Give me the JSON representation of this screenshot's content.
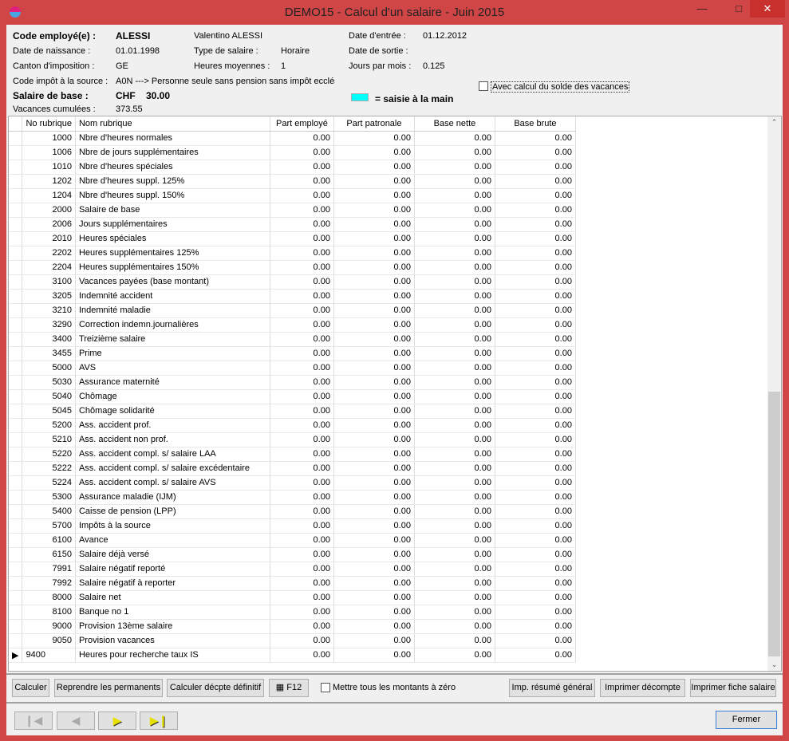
{
  "window": {
    "title": "DEMO15 - Calcul d'un salaire - Juin 2015"
  },
  "header": {
    "code_label": "Code employé(e) :",
    "code_value": "ALESSI",
    "full_name": "Valentino ALESSI",
    "birth_label": "Date de naissance :",
    "birth_value": "01.01.1998",
    "canton_label": "Canton d'imposition :",
    "canton_value": "GE",
    "tax_label": "Code impôt à la source :",
    "tax_value": "A0N ---> Personne seule sans pension sans impôt ecclési",
    "salary_label": "Salaire de  base :",
    "salary_currency": "CHF",
    "salary_value": "30.00",
    "vacation_label": "Vacances cumulées :",
    "vacation_value": "373.55",
    "type_label": "Type de salaire :",
    "type_value": "Horaire",
    "hours_label": "Heures moyennes :",
    "hours_value": "1",
    "entry_label": "Date d'entrée :",
    "entry_value": "01.12.2012",
    "exit_label": "Date de sortie :",
    "exit_value": "",
    "days_label": "Jours par mois :",
    "days_value": "0.125",
    "vac_checkbox_label": "Avec calcul du solde des vacances",
    "legend_label": "= saisie à la main",
    "legend_color": "#00ffff"
  },
  "table": {
    "columns": [
      "No rubrique",
      "Nom rubrique",
      "Part employé",
      "Part patronale",
      "Base nette",
      "Base brute"
    ],
    "rows": [
      [
        "1000",
        "Nbre d'heures normales",
        "0.00",
        "0.00",
        "0.00",
        "0.00"
      ],
      [
        "1006",
        "Nbre de jours supplémentaires",
        "0.00",
        "0.00",
        "0.00",
        "0.00"
      ],
      [
        "1010",
        "Nbre d'heures spéciales",
        "0.00",
        "0.00",
        "0.00",
        "0.00"
      ],
      [
        "1202",
        "Nbre d'heures suppl. 125%",
        "0.00",
        "0.00",
        "0.00",
        "0.00"
      ],
      [
        "1204",
        "Nbre d'heures suppl. 150%",
        "0.00",
        "0.00",
        "0.00",
        "0.00"
      ],
      [
        "2000",
        "Salaire de base",
        "0.00",
        "0.00",
        "0.00",
        "0.00"
      ],
      [
        "2006",
        "Jours supplémentaires",
        "0.00",
        "0.00",
        "0.00",
        "0.00"
      ],
      [
        "2010",
        "Heures spéciales",
        "0.00",
        "0.00",
        "0.00",
        "0.00"
      ],
      [
        "2202",
        "Heures supplémentaires 125%",
        "0.00",
        "0.00",
        "0.00",
        "0.00"
      ],
      [
        "2204",
        "Heures supplémentaires 150%",
        "0.00",
        "0.00",
        "0.00",
        "0.00"
      ],
      [
        "3100",
        "Vacances payées (base montant)",
        "0.00",
        "0.00",
        "0.00",
        "0.00"
      ],
      [
        "3205",
        "Indemnité accident",
        "0.00",
        "0.00",
        "0.00",
        "0.00"
      ],
      [
        "3210",
        "Indemnité maladie",
        "0.00",
        "0.00",
        "0.00",
        "0.00"
      ],
      [
        "3290",
        "Correction indemn.journalières",
        "0.00",
        "0.00",
        "0.00",
        "0.00"
      ],
      [
        "3400",
        "Treizième salaire",
        "0.00",
        "0.00",
        "0.00",
        "0.00"
      ],
      [
        "3455",
        "Prime",
        "0.00",
        "0.00",
        "0.00",
        "0.00"
      ],
      [
        "5000",
        "AVS",
        "0.00",
        "0.00",
        "0.00",
        "0.00"
      ],
      [
        "5030",
        "Assurance maternité",
        "0.00",
        "0.00",
        "0.00",
        "0.00"
      ],
      [
        "5040",
        "Chômage",
        "0.00",
        "0.00",
        "0.00",
        "0.00"
      ],
      [
        "5045",
        "Chômage solidarité",
        "0.00",
        "0.00",
        "0.00",
        "0.00"
      ],
      [
        "5200",
        "Ass. accident prof.",
        "0.00",
        "0.00",
        "0.00",
        "0.00"
      ],
      [
        "5210",
        "Ass. accident non prof.",
        "0.00",
        "0.00",
        "0.00",
        "0.00"
      ],
      [
        "5220",
        "Ass. accident compl. s/ salaire LAA",
        "0.00",
        "0.00",
        "0.00",
        "0.00"
      ],
      [
        "5222",
        "Ass. accident compl. s/ salaire excédentaire",
        "0.00",
        "0.00",
        "0.00",
        "0.00"
      ],
      [
        "5224",
        "Ass. accident compl. s/ salaire AVS",
        "0.00",
        "0.00",
        "0.00",
        "0.00"
      ],
      [
        "5300",
        "Assurance maladie (IJM)",
        "0.00",
        "0.00",
        "0.00",
        "0.00"
      ],
      [
        "5400",
        "Caisse de pension (LPP)",
        "0.00",
        "0.00",
        "0.00",
        "0.00"
      ],
      [
        "5700",
        "Impôts à la source",
        "0.00",
        "0.00",
        "0.00",
        "0.00"
      ],
      [
        "6100",
        "Avance",
        "0.00",
        "0.00",
        "0.00",
        "0.00"
      ],
      [
        "6150",
        "Salaire déjà versé",
        "0.00",
        "0.00",
        "0.00",
        "0.00"
      ],
      [
        "7991",
        "Salaire négatif reporté",
        "0.00",
        "0.00",
        "0.00",
        "0.00"
      ],
      [
        "7992",
        "Salaire négatif à reporter",
        "0.00",
        "0.00",
        "0.00",
        "0.00"
      ],
      [
        "8000",
        "Salaire net",
        "0.00",
        "0.00",
        "0.00",
        "0.00"
      ],
      [
        "8100",
        "Banque no 1",
        "0.00",
        "0.00",
        "0.00",
        "0.00"
      ],
      [
        "9000",
        "Provision 13ème salaire",
        "0.00",
        "0.00",
        "0.00",
        "0.00"
      ],
      [
        "9050",
        "Provision vacances",
        "0.00",
        "0.00",
        "0.00",
        "0.00"
      ],
      [
        "9400",
        "Heures pour recherche taux IS",
        "0.00",
        "0.00",
        "0.00",
        "0.00"
      ]
    ]
  },
  "buttons": {
    "calculer": "Calculer",
    "reprendre": "Reprendre les permanents",
    "definitif": "Calculer décpte définitif",
    "f12": "F12",
    "zero_label": "Mettre tous les montants à zéro",
    "resume": "Imp. résumé général",
    "decompte": "Imprimer  décompte",
    "fiche": "Imprimer fiche salaire",
    "fermer": "Fermer"
  }
}
